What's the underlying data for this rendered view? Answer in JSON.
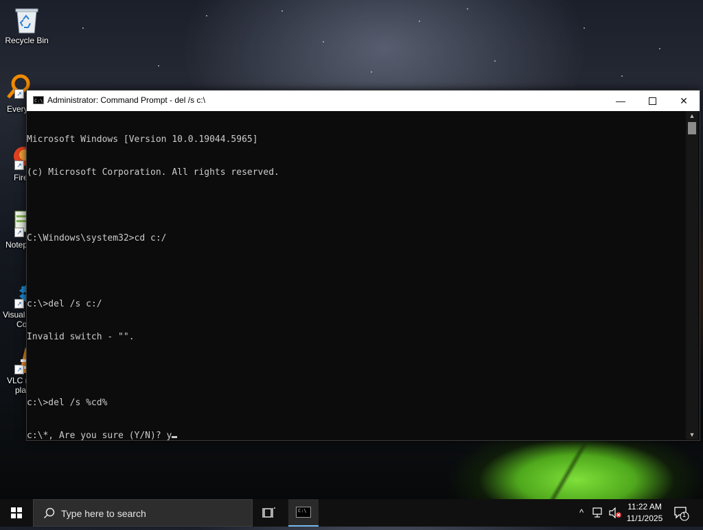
{
  "desktop": {
    "icons": [
      {
        "label": "Recycle Bin",
        "icon": "recycle-bin-icon"
      },
      {
        "label": "Every",
        "icon": "everything-icon"
      },
      {
        "label": "Fire",
        "icon": "firefox-icon"
      },
      {
        "label": "Notep",
        "icon": "notepad-icon"
      },
      {
        "label": "Visual",
        "label2": "Co",
        "icon": "vscode-icon"
      },
      {
        "label": "VLC r",
        "label2": "pla",
        "icon": "vlc-icon"
      }
    ]
  },
  "window": {
    "title": "Administrator: Command Prompt - del  /s c:\\",
    "icon_text": "C:\\.",
    "controls": {
      "minimize": "—",
      "close": "✕"
    }
  },
  "console": {
    "lines": [
      "Microsoft Windows [Version 10.0.19044.5965]",
      "(c) Microsoft Corporation. All rights reserved.",
      "",
      "C:\\Windows\\system32>cd c:/",
      "",
      "c:\\>del /s c:/",
      "Invalid switch - \"\".",
      "",
      "c:\\>del /s %cd%",
      "c:\\*, Are you sure (Y/N)? y"
    ]
  },
  "taskbar": {
    "search_placeholder": "Type here to search",
    "clock_time": "11:22 AM",
    "clock_date": "11/1/2025",
    "notification_count": "1",
    "accent": "#76b9ed"
  }
}
